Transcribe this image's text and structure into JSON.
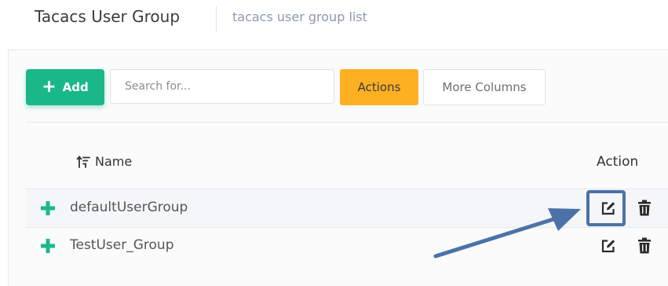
{
  "header": {
    "title": "Tacacs User Group",
    "breadcrumb": "tacacs user group list"
  },
  "toolbar": {
    "add_label": "Add",
    "search_placeholder": "Search for...",
    "actions_label": "Actions",
    "more_columns_label": "More Columns"
  },
  "table": {
    "columns": {
      "name": "Name",
      "action": "Action"
    },
    "rows": [
      {
        "name": "defaultUserGroup"
      },
      {
        "name": "TestUser_Group"
      }
    ]
  },
  "colors": {
    "add_button": "#1ab888",
    "actions_button": "#fdb022",
    "breadcrumb": "#8d97b5",
    "annotation": "#4b72a8"
  },
  "icons": {
    "add": "plus-icon",
    "sort": "sort-icon",
    "expand": "plus-icon",
    "edit": "edit-icon",
    "delete": "trash-icon"
  }
}
